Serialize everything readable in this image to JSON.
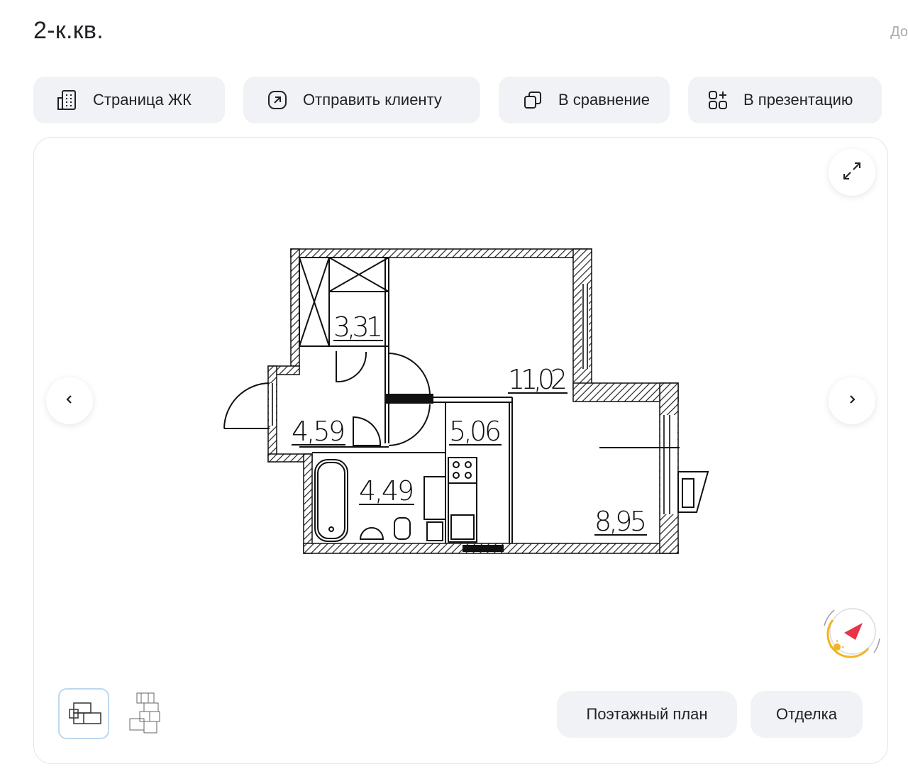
{
  "header": {
    "title": "2-к.кв.",
    "right_text": "До"
  },
  "toolbar": {
    "complex_page": "Страница ЖК",
    "send_client": "Отправить клиенту",
    "compare": "В сравнение",
    "presentation": "В презентацию"
  },
  "plan": {
    "rooms": [
      "3,31",
      "11,02",
      "4,59",
      "5,06",
      "4,49",
      "8,95"
    ]
  },
  "bottom": {
    "floor_plan": "Поэтажный план",
    "finishing": "Отделка"
  },
  "icons": {
    "complex": "building-icon",
    "send": "arrow-up-right-icon",
    "compare": "copy-icon",
    "presentation": "grid-plus-icon",
    "expand": "expand-icon",
    "prev": "chevron-left-icon",
    "next": "chevron-right-icon",
    "compass": "compass-icon"
  },
  "colors": {
    "accent_red": "#e8334a",
    "sun": "#f2b41f",
    "selected_border": "#bcd8f0"
  }
}
